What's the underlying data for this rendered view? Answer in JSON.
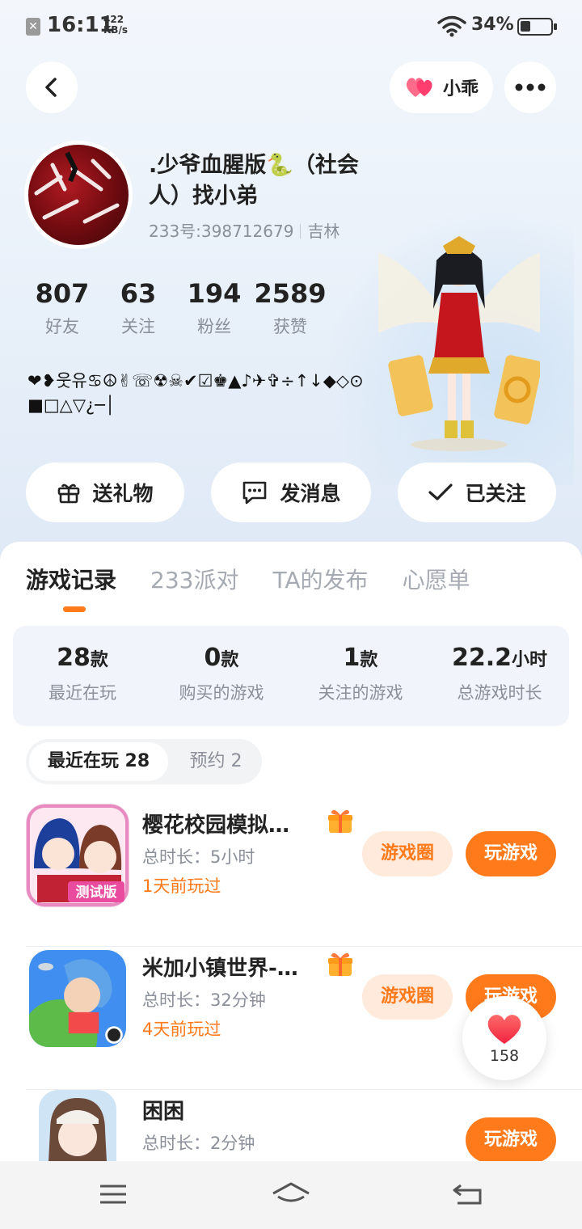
{
  "status_bar": {
    "time": "16:11",
    "net_speed_value": "422",
    "net_speed_unit": "KB/s",
    "battery_text": "34%",
    "battery_level": 0.34
  },
  "header": {
    "partner_label": "小乖"
  },
  "profile": {
    "nickname": ".少爷血腥版🐍（社会人）找小弟",
    "uid_label": "233号:398712679",
    "region": "吉林",
    "signature": "❤❥웃유♋☮✌☏☢☠✔☑♚▲♪✈✞÷↑↓◆◇⊙■□△▽¿─│",
    "stats": [
      {
        "value": "807",
        "label": "好友"
      },
      {
        "value": "63",
        "label": "关注"
      },
      {
        "value": "194",
        "label": "粉丝"
      },
      {
        "value": "2589",
        "label": "获赞"
      }
    ]
  },
  "actions": {
    "gift": "送礼物",
    "message": "发消息",
    "follow": "已关注"
  },
  "tabs": [
    "游戏记录",
    "233派对",
    "TA的发布",
    "心愿单"
  ],
  "summary": [
    {
      "num": "28",
      "unit": "款",
      "label": "最近在玩"
    },
    {
      "num": "0",
      "unit": "款",
      "label": "购买的游戏"
    },
    {
      "num": "1",
      "unit": "款",
      "label": "关注的游戏"
    },
    {
      "num": "22.2",
      "unit": "小时",
      "label": "总游戏时长"
    }
  ],
  "segments": {
    "recent": "最近在玩 28",
    "reserve": "预约 2"
  },
  "games": [
    {
      "title": "樱花校园模拟…",
      "duration": "总时长：5小时",
      "last_played": "1天前玩过",
      "circle": "游戏圈",
      "play": "玩游戏",
      "icon_badge": "测试版"
    },
    {
      "title": "米加小镇世界-…",
      "duration": "总时长：32分钟",
      "last_played": "4天前玩过",
      "circle": "游戏圈",
      "play": "玩游戏"
    },
    {
      "title": "困困",
      "duration": "总时长：2分钟",
      "play": "玩游戏"
    }
  ],
  "like_fab": {
    "count": "158"
  },
  "colors": {
    "accent": "#ff7a1a",
    "accent_light": "#ffeadb",
    "muted_text": "#8a8f99",
    "hero_bg": "#e8f0f9"
  },
  "icons": {
    "back": "chevron-left-icon",
    "more": "more-dots-icon",
    "partner": "double-heart-icon",
    "gift": "gift-icon",
    "message": "chat-bubble-icon",
    "follow": "check-icon",
    "like": "heart-icon",
    "nav_menu": "menu-icon",
    "nav_home": "home-icon",
    "nav_back": "return-icon"
  }
}
